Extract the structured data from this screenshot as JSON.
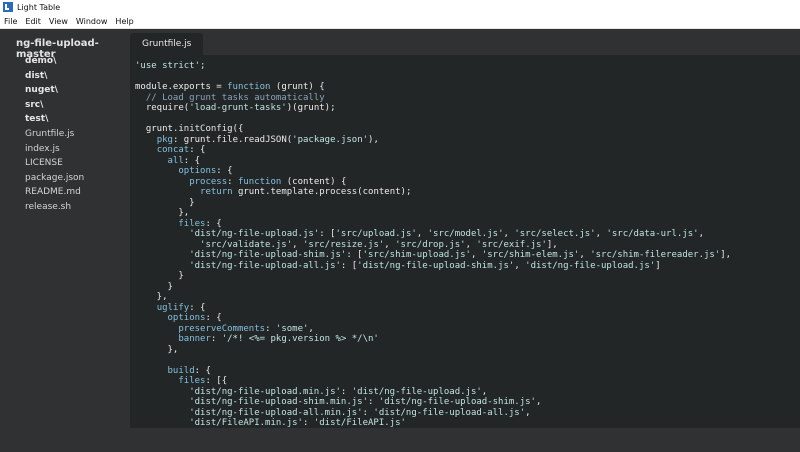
{
  "window": {
    "title": "Light Table"
  },
  "menu": [
    "File",
    "Edit",
    "View",
    "Window",
    "Help"
  ],
  "sidebar": {
    "title": "ng-file-upload-master",
    "items": [
      {
        "label": "demo\\",
        "type": "folder"
      },
      {
        "label": "dist\\",
        "type": "folder"
      },
      {
        "label": "nuget\\",
        "type": "folder"
      },
      {
        "label": "src\\",
        "type": "folder"
      },
      {
        "label": "test\\",
        "type": "folder"
      },
      {
        "label": "Gruntfile.js",
        "type": "file"
      },
      {
        "label": "index.js",
        "type": "file"
      },
      {
        "label": "LICENSE",
        "type": "file"
      },
      {
        "label": "package.json",
        "type": "file"
      },
      {
        "label": "README.md",
        "type": "file"
      },
      {
        "label": "release.sh",
        "type": "file"
      }
    ]
  },
  "tabs": [
    {
      "label": "Gruntfile.js",
      "active": true
    }
  ],
  "editor": {
    "lines": [
      [
        [
          "str",
          "'use strict';"
        ]
      ],
      [],
      [
        [
          "var",
          "module.exports"
        ],
        [
          "",
          " = "
        ],
        [
          "key",
          "function"
        ],
        [
          "",
          " ("
        ],
        [
          "var",
          "grunt"
        ],
        [
          "",
          ") {"
        ]
      ],
      [
        [
          "cmt",
          "  // Load grunt tasks automatically"
        ]
      ],
      [
        [
          "",
          "  require("
        ],
        [
          "str",
          "'load-grunt-tasks'"
        ],
        [
          "",
          ")("
        ],
        [
          "var",
          "grunt"
        ],
        [
          "",
          ");"
        ]
      ],
      [],
      [
        [
          "var",
          "  grunt"
        ],
        [
          "",
          ".initConfig({"
        ]
      ],
      [
        [
          "",
          "    "
        ],
        [
          "key",
          "pkg"
        ],
        [
          "",
          ": "
        ],
        [
          "var",
          "grunt"
        ],
        [
          "",
          ".file.readJSON("
        ],
        [
          "str",
          "'package.json'"
        ],
        [
          "",
          "),"
        ]
      ],
      [
        [
          "",
          "    "
        ],
        [
          "key",
          "concat"
        ],
        [
          "",
          ": {"
        ]
      ],
      [
        [
          "",
          "      "
        ],
        [
          "key",
          "all"
        ],
        [
          "",
          ": {"
        ]
      ],
      [
        [
          "",
          "        "
        ],
        [
          "key",
          "options"
        ],
        [
          "",
          ": {"
        ]
      ],
      [
        [
          "",
          "          "
        ],
        [
          "key",
          "process"
        ],
        [
          "",
          ": "
        ],
        [
          "key",
          "function"
        ],
        [
          "",
          " ("
        ],
        [
          "var",
          "content"
        ],
        [
          "",
          ") {"
        ]
      ],
      [
        [
          "",
          "            "
        ],
        [
          "key",
          "return"
        ],
        [
          "var",
          " grunt"
        ],
        [
          "",
          ".template.process("
        ],
        [
          "var",
          "content"
        ],
        [
          "",
          ");"
        ]
      ],
      [
        [
          "",
          "          }"
        ]
      ],
      [
        [
          "",
          "        },"
        ]
      ],
      [
        [
          "",
          "        "
        ],
        [
          "key",
          "files"
        ],
        [
          "",
          ": {"
        ]
      ],
      [
        [
          "",
          "          "
        ],
        [
          "str",
          "'dist/ng-file-upload.js'"
        ],
        [
          "",
          ": ["
        ],
        [
          "str",
          "'src/upload.js'"
        ],
        [
          "",
          ", "
        ],
        [
          "str",
          "'src/model.js'"
        ],
        [
          "",
          ", "
        ],
        [
          "str",
          "'src/select.js'"
        ],
        [
          "",
          ", "
        ],
        [
          "str",
          "'src/data-url.js'"
        ],
        [
          "",
          ","
        ]
      ],
      [
        [
          "",
          "            "
        ],
        [
          "str",
          "'src/validate.js'"
        ],
        [
          "",
          ", "
        ],
        [
          "str",
          "'src/resize.js'"
        ],
        [
          "",
          ", "
        ],
        [
          "str",
          "'src/drop.js'"
        ],
        [
          "",
          ", "
        ],
        [
          "str",
          "'src/exif.js'"
        ],
        [
          "",
          "],"
        ]
      ],
      [
        [
          "",
          "          "
        ],
        [
          "str",
          "'dist/ng-file-upload-shim.js'"
        ],
        [
          "",
          ": ["
        ],
        [
          "str",
          "'src/shim-upload.js'"
        ],
        [
          "",
          ", "
        ],
        [
          "str",
          "'src/shim-elem.js'"
        ],
        [
          "",
          ", "
        ],
        [
          "str",
          "'src/shim-filereader.js'"
        ],
        [
          "",
          "],"
        ]
      ],
      [
        [
          "",
          "          "
        ],
        [
          "str",
          "'dist/ng-file-upload-all.js'"
        ],
        [
          "",
          ": ["
        ],
        [
          "str",
          "'dist/ng-file-upload-shim.js'"
        ],
        [
          "",
          ", "
        ],
        [
          "str",
          "'dist/ng-file-upload.js'"
        ],
        [
          "",
          "]"
        ]
      ],
      [
        [
          "",
          "        }"
        ]
      ],
      [
        [
          "",
          "      }"
        ]
      ],
      [
        [
          "",
          "    },"
        ]
      ],
      [
        [
          "",
          "    "
        ],
        [
          "key",
          "uglify"
        ],
        [
          "",
          ": {"
        ]
      ],
      [
        [
          "",
          "      "
        ],
        [
          "key",
          "options"
        ],
        [
          "",
          ": {"
        ]
      ],
      [
        [
          "",
          "        "
        ],
        [
          "key",
          "preserveComments"
        ],
        [
          "",
          ": "
        ],
        [
          "str",
          "'some'"
        ],
        [
          "",
          ","
        ]
      ],
      [
        [
          "",
          "        "
        ],
        [
          "key",
          "banner"
        ],
        [
          "",
          ": "
        ],
        [
          "str",
          "'/*! <%= pkg.version %> */\\n'"
        ]
      ],
      [
        [
          "",
          "      },"
        ]
      ],
      [],
      [
        [
          "",
          "      "
        ],
        [
          "key",
          "build"
        ],
        [
          "",
          ": {"
        ]
      ],
      [
        [
          "",
          "        "
        ],
        [
          "key",
          "files"
        ],
        [
          "",
          ": [{"
        ]
      ],
      [
        [
          "",
          "          "
        ],
        [
          "str",
          "'dist/ng-file-upload.min.js'"
        ],
        [
          "",
          ": "
        ],
        [
          "str",
          "'dist/ng-file-upload.js'"
        ],
        [
          "",
          ","
        ]
      ],
      [
        [
          "",
          "          "
        ],
        [
          "str",
          "'dist/ng-file-upload-shim.min.js'"
        ],
        [
          "",
          ": "
        ],
        [
          "str",
          "'dist/ng-file-upload-shim.js'"
        ],
        [
          "",
          ","
        ]
      ],
      [
        [
          "",
          "          "
        ],
        [
          "str",
          "'dist/ng-file-upload-all.min.js'"
        ],
        [
          "",
          ": "
        ],
        [
          "str",
          "'dist/ng-file-upload-all.js'"
        ],
        [
          "",
          ","
        ]
      ],
      [
        [
          "",
          "          "
        ],
        [
          "str",
          "'dist/FileAPI.min.js'"
        ],
        [
          "",
          ": "
        ],
        [
          "str",
          "'dist/FileAPI.js'"
        ]
      ],
      [
        [
          "",
          "        }]"
        ]
      ],
      [
        [
          "",
          "      }"
        ]
      ],
      [
        [
          "",
          "    }"
        ]
      ]
    ]
  },
  "colors": {
    "background": "#2f3133",
    "editor": "#232627",
    "keyword": "#84c0e0",
    "string": "#bfe4e0",
    "comment": "#89a3bb",
    "text": "#e8e8e8"
  }
}
